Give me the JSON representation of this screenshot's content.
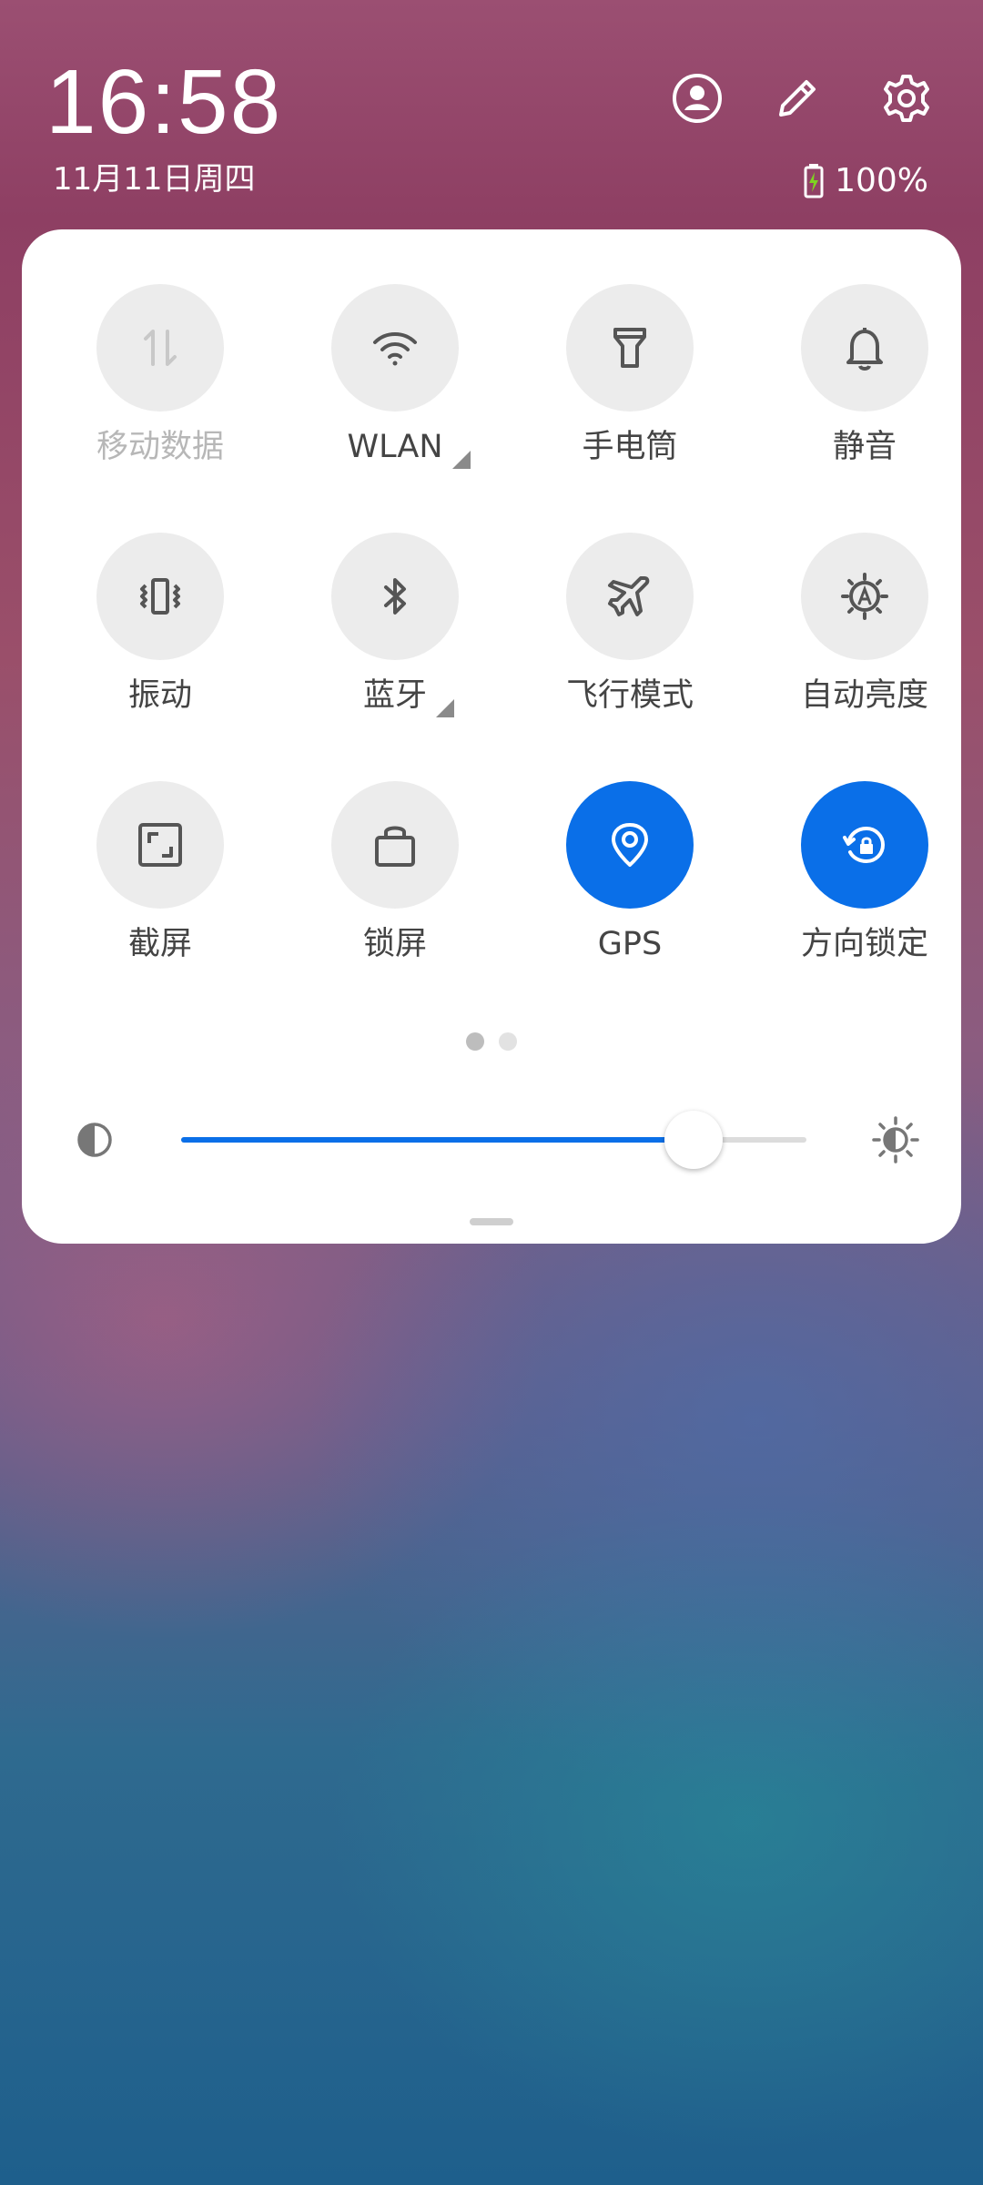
{
  "status": {
    "time": "16:58",
    "date": "11月11日周四",
    "battery_text": "100%",
    "battery_color": "#7ed321"
  },
  "header_icons": [
    "account-icon",
    "edit-icon",
    "settings-icon"
  ],
  "tiles": [
    {
      "label": "移动数据",
      "icon": "mobile-data-icon",
      "active": false,
      "disabled": true
    },
    {
      "label": "WLAN",
      "icon": "wifi-icon",
      "active": false,
      "has_menu": true
    },
    {
      "label": "手电筒",
      "icon": "flashlight-icon",
      "active": false
    },
    {
      "label": "静音",
      "icon": "bell-icon",
      "active": false
    },
    {
      "label": "振动",
      "icon": "vibrate-icon",
      "active": false
    },
    {
      "label": "蓝牙",
      "icon": "bluetooth-icon",
      "active": false,
      "has_menu": true
    },
    {
      "label": "飞行模式",
      "icon": "airplane-icon",
      "active": false
    },
    {
      "label": "自动亮度",
      "icon": "auto-brightness-icon",
      "active": false
    },
    {
      "label": "截屏",
      "icon": "screenshot-icon",
      "active": false
    },
    {
      "label": "锁屏",
      "icon": "lock-icon",
      "active": false
    },
    {
      "label": "GPS",
      "icon": "location-icon",
      "active": true
    },
    {
      "label": "方向锁定",
      "icon": "rotation-lock-icon",
      "active": true
    }
  ],
  "pager": {
    "pages": 2,
    "current": 1
  },
  "brightness": {
    "level": 0.82
  },
  "colors": {
    "accent": "#0a6fe8",
    "tile_bg": "#ececec"
  }
}
